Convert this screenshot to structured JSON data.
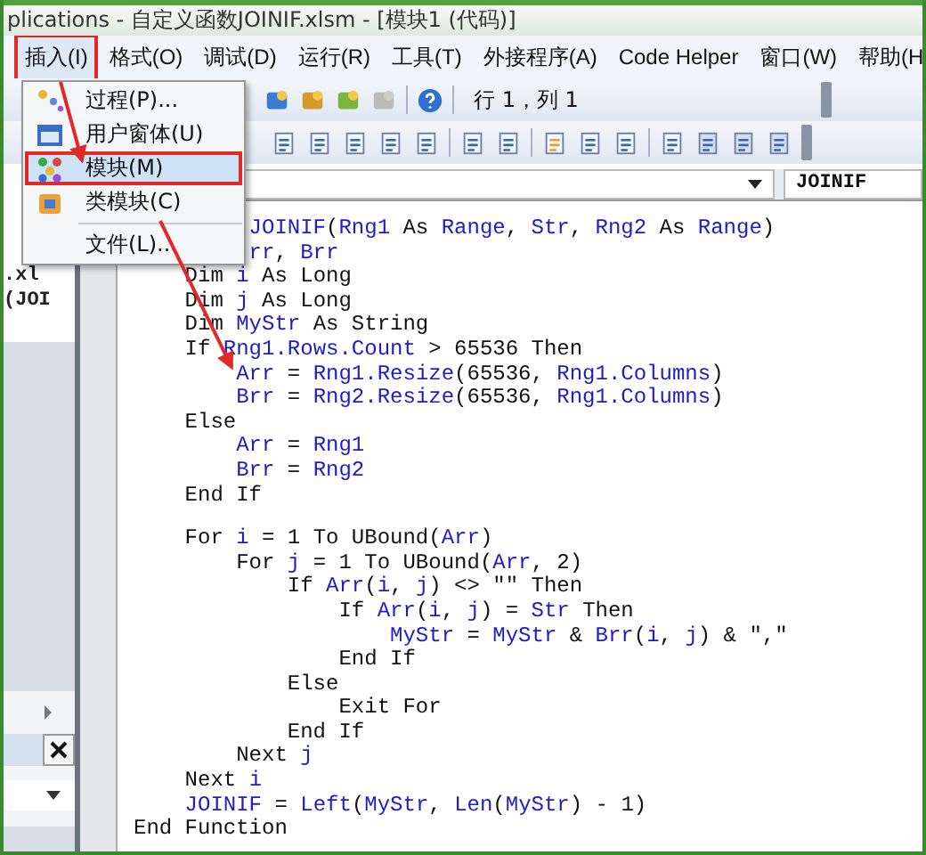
{
  "window": {
    "title": "plications - 自定义函数JOINIF.xlsm - [模块1 (代码)]"
  },
  "menu_bar": [
    {
      "label": "插入(I)",
      "selected": true,
      "annotated": true
    },
    {
      "label": "格式(O)",
      "selected": false,
      "annotated": false
    },
    {
      "label": "调试(D)",
      "selected": false,
      "annotated": false
    },
    {
      "label": "运行(R)",
      "selected": false,
      "annotated": false
    },
    {
      "label": "工具(T)",
      "selected": false,
      "annotated": false
    },
    {
      "label": "外接程序(A)",
      "selected": false,
      "annotated": false
    },
    {
      "label": "Code Helper",
      "selected": false,
      "annotated": false
    },
    {
      "label": "窗口(W)",
      "selected": false,
      "annotated": false
    },
    {
      "label": "帮助(H",
      "selected": false,
      "annotated": false
    }
  ],
  "insert_menu": [
    {
      "label": "过程(P)...",
      "selected": false,
      "annotated": false
    },
    {
      "label": "用户窗体(U)",
      "selected": false,
      "annotated": false
    },
    {
      "label": "模块(M)",
      "selected": true,
      "annotated": true
    },
    {
      "label": "类模块(C)",
      "selected": false,
      "annotated": false
    },
    {
      "label": "文件(L)...",
      "selected": false,
      "annotated": false,
      "separator_before": true
    }
  ],
  "toolbar": {
    "position": "行 1，列 1"
  },
  "project_explorer": {
    "items": [
      ".xl",
      "(JOI"
    ]
  },
  "code_window": {
    "procedure": "JOINIF",
    "lines": [
      {
        "segments": [
          {
            "text": "         JOINIF",
            "kind": "name"
          },
          {
            "text": "(",
            "kind": "keyword"
          },
          {
            "text": "Rng1",
            "kind": "name"
          },
          {
            "text": " As ",
            "kind": "keyword"
          },
          {
            "text": "Range",
            "kind": "name"
          },
          {
            "text": ", ",
            "kind": "keyword"
          },
          {
            "text": "Str",
            "kind": "name"
          },
          {
            "text": ", ",
            "kind": "keyword"
          },
          {
            "text": "Rng2",
            "kind": "name"
          },
          {
            "text": " As ",
            "kind": "keyword"
          },
          {
            "text": "Range",
            "kind": "name"
          },
          {
            "text": ")",
            "kind": "keyword"
          }
        ]
      },
      {
        "segments": [
          {
            "text": "         rr",
            "kind": "name"
          },
          {
            "text": ", ",
            "kind": "keyword"
          },
          {
            "text": "Brr",
            "kind": "name"
          }
        ]
      },
      {
        "segments": [
          {
            "text": "    Dim ",
            "kind": "keyword"
          },
          {
            "text": "i",
            "kind": "name"
          },
          {
            "text": " As Long",
            "kind": "keyword"
          }
        ]
      },
      {
        "segments": [
          {
            "text": "    Dim ",
            "kind": "keyword"
          },
          {
            "text": "j",
            "kind": "name"
          },
          {
            "text": " As Long",
            "kind": "keyword"
          }
        ]
      },
      {
        "segments": [
          {
            "text": "    Dim ",
            "kind": "keyword"
          },
          {
            "text": "MyStr",
            "kind": "name"
          },
          {
            "text": " As String",
            "kind": "keyword"
          }
        ]
      },
      {
        "segments": [
          {
            "text": "    If ",
            "kind": "keyword"
          },
          {
            "text": "Rng1.Rows.Count",
            "kind": "name"
          },
          {
            "text": " > 65536 Then",
            "kind": "keyword"
          }
        ]
      },
      {
        "segments": [
          {
            "text": "        Arr",
            "kind": "name"
          },
          {
            "text": " = ",
            "kind": "keyword"
          },
          {
            "text": "Rng1.Resize",
            "kind": "name"
          },
          {
            "text": "(65536, ",
            "kind": "keyword"
          },
          {
            "text": "Rng1.Columns",
            "kind": "name"
          },
          {
            "text": ")",
            "kind": "keyword"
          }
        ]
      },
      {
        "segments": [
          {
            "text": "        Brr",
            "kind": "name"
          },
          {
            "text": " = ",
            "kind": "keyword"
          },
          {
            "text": "Rng2.Resize",
            "kind": "name"
          },
          {
            "text": "(65536, ",
            "kind": "keyword"
          },
          {
            "text": "Rng1.Columns",
            "kind": "name"
          },
          {
            "text": ")",
            "kind": "keyword"
          }
        ]
      },
      {
        "segments": [
          {
            "text": "    Else",
            "kind": "keyword"
          }
        ]
      },
      {
        "segments": [
          {
            "text": "        Arr",
            "kind": "name"
          },
          {
            "text": " = ",
            "kind": "keyword"
          },
          {
            "text": "Rng1",
            "kind": "name"
          }
        ]
      },
      {
        "segments": [
          {
            "text": "        Brr",
            "kind": "name"
          },
          {
            "text": " = ",
            "kind": "keyword"
          },
          {
            "text": "Rng2",
            "kind": "name"
          }
        ]
      },
      {
        "segments": [
          {
            "text": "    End If",
            "kind": "keyword"
          }
        ]
      },
      {
        "gap_before": true,
        "segments": [
          {
            "text": "    For ",
            "kind": "keyword"
          },
          {
            "text": "i",
            "kind": "name"
          },
          {
            "text": " = 1 To UBound(",
            "kind": "keyword"
          },
          {
            "text": "Arr",
            "kind": "name"
          },
          {
            "text": ")",
            "kind": "keyword"
          }
        ]
      },
      {
        "segments": [
          {
            "text": "        For ",
            "kind": "keyword"
          },
          {
            "text": "j",
            "kind": "name"
          },
          {
            "text": " = 1 To UBound(",
            "kind": "keyword"
          },
          {
            "text": "Arr",
            "kind": "name"
          },
          {
            "text": ", 2)",
            "kind": "keyword"
          }
        ]
      },
      {
        "segments": [
          {
            "text": "            If ",
            "kind": "keyword"
          },
          {
            "text": "Arr",
            "kind": "name"
          },
          {
            "text": "(",
            "kind": "keyword"
          },
          {
            "text": "i",
            "kind": "name"
          },
          {
            "text": ", ",
            "kind": "keyword"
          },
          {
            "text": "j",
            "kind": "name"
          },
          {
            "text": ") <> \"\" Then",
            "kind": "keyword"
          }
        ]
      },
      {
        "segments": [
          {
            "text": "                If ",
            "kind": "keyword"
          },
          {
            "text": "Arr",
            "kind": "name"
          },
          {
            "text": "(",
            "kind": "keyword"
          },
          {
            "text": "i",
            "kind": "name"
          },
          {
            "text": ", ",
            "kind": "keyword"
          },
          {
            "text": "j",
            "kind": "name"
          },
          {
            "text": ") = ",
            "kind": "keyword"
          },
          {
            "text": "Str",
            "kind": "name"
          },
          {
            "text": " Then",
            "kind": "keyword"
          }
        ]
      },
      {
        "segments": [
          {
            "text": "                    MyStr",
            "kind": "name"
          },
          {
            "text": " = ",
            "kind": "keyword"
          },
          {
            "text": "MyStr",
            "kind": "name"
          },
          {
            "text": " & ",
            "kind": "keyword"
          },
          {
            "text": "Brr",
            "kind": "name"
          },
          {
            "text": "(",
            "kind": "keyword"
          },
          {
            "text": "i",
            "kind": "name"
          },
          {
            "text": ", ",
            "kind": "keyword"
          },
          {
            "text": "j",
            "kind": "name"
          },
          {
            "text": ") & \",\"",
            "kind": "keyword"
          }
        ]
      },
      {
        "segments": [
          {
            "text": "                End If",
            "kind": "keyword"
          }
        ]
      },
      {
        "segments": [
          {
            "text": "            Else",
            "kind": "keyword"
          }
        ]
      },
      {
        "segments": [
          {
            "text": "                Exit For",
            "kind": "keyword"
          }
        ]
      },
      {
        "segments": [
          {
            "text": "            End If",
            "kind": "keyword"
          }
        ]
      },
      {
        "segments": [
          {
            "text": "        Next ",
            "kind": "keyword"
          },
          {
            "text": "j",
            "kind": "name"
          }
        ]
      },
      {
        "segments": [
          {
            "text": "    Next ",
            "kind": "keyword"
          },
          {
            "text": "i",
            "kind": "name"
          }
        ]
      },
      {
        "segments": [
          {
            "text": "    JOINIF",
            "kind": "name"
          },
          {
            "text": " = ",
            "kind": "keyword"
          },
          {
            "text": "Left",
            "kind": "name"
          },
          {
            "text": "(",
            "kind": "keyword"
          },
          {
            "text": "MyStr",
            "kind": "name"
          },
          {
            "text": ", ",
            "kind": "keyword"
          },
          {
            "text": "Len",
            "kind": "name"
          },
          {
            "text": "(",
            "kind": "keyword"
          },
          {
            "text": "MyStr",
            "kind": "name"
          },
          {
            "text": ") - 1)",
            "kind": "keyword"
          }
        ]
      },
      {
        "segments": [
          {
            "text": "End Function",
            "kind": "keyword"
          }
        ]
      }
    ]
  }
}
